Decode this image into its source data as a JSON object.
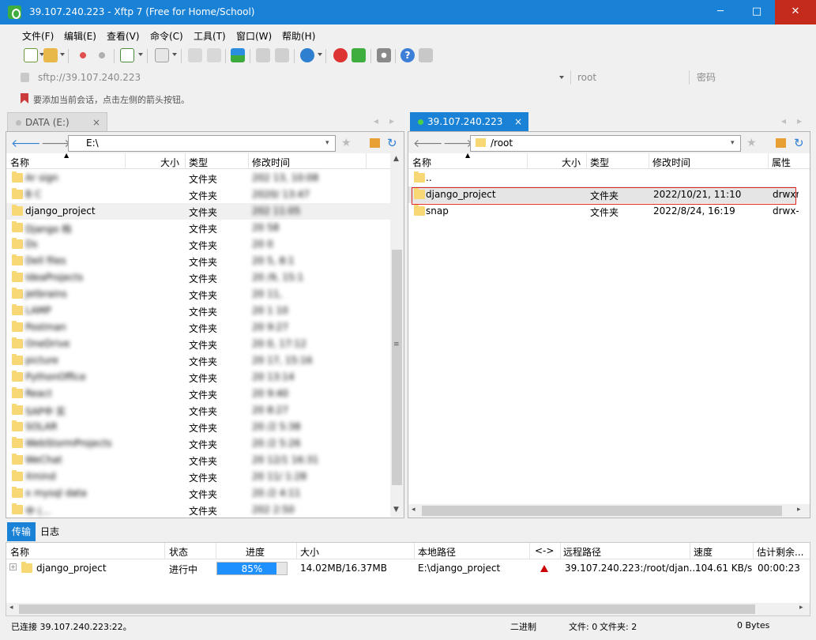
{
  "window": {
    "title": "39.107.240.223 - Xftp 7 (Free for Home/School)",
    "min": "─",
    "max": "□",
    "close": "✕"
  },
  "menu": [
    "文件(F)",
    "编辑(E)",
    "查看(V)",
    "命令(C)",
    "工具(T)",
    "窗口(W)",
    "帮助(H)"
  ],
  "address": {
    "url": "sftp://39.107.240.223",
    "user": "root",
    "password_placeholder": "密码"
  },
  "hint": "要添加当前会话，点击左侧的箭头按钮。",
  "left_pane": {
    "tab": "DATA (E:)",
    "path": "E:\\",
    "columns": [
      "名称",
      "大小",
      "类型",
      "修改时间"
    ],
    "rows": [
      {
        "name": "Ar      sign",
        "type": "文件夹",
        "modified": "202     13, 10:08"
      },
      {
        "name": "B          C",
        "type": "文件夹",
        "modified": "2020/      13:47"
      },
      {
        "name": "django_project",
        "type": "文件夹",
        "modified": "202        11:05"
      },
      {
        "name": "Django        档",
        "type": "文件夹",
        "modified": "20          58"
      },
      {
        "name": "Ds",
        "type": "文件夹",
        "modified": "20          0"
      },
      {
        "name": "Dell files",
        "type": "文件夹",
        "modified": "20       5, 8:1"
      },
      {
        "name": "IdeaProjects",
        "type": "文件夹",
        "modified": "20     /9, 15:1"
      },
      {
        "name": "Jetbrains",
        "type": "文件夹",
        "modified": "20      11,"
      },
      {
        "name": "LAMP",
        "type": "文件夹",
        "modified": "20        1 10"
      },
      {
        "name": "Postman",
        "type": "文件夹",
        "modified": "20         9:27"
      },
      {
        "name": "OneDrive",
        "type": "文件夹",
        "modified": "20        0, 17:12"
      },
      {
        "name": "picture",
        "type": "文件夹",
        "modified": "20        17, 15:16"
      },
      {
        "name": "PythonOffice",
        "type": "文件夹",
        "modified": "20         13:14"
      },
      {
        "name": "React",
        "type": "文件夹",
        "modified": "20          9:40"
      },
      {
        "name": "SAP中  实 ",
        "type": "文件夹",
        "modified": "20       8:27"
      },
      {
        "name": "SOLAR",
        "type": "文件夹",
        "modified": "20      /2   5:38"
      },
      {
        "name": "WebStormProjects",
        "type": "文件夹",
        "modified": "20      /2   5:26"
      },
      {
        "name": "WeChat",
        "type": "文件夹",
        "modified": "20  12/1  16:31"
      },
      {
        "name": "Xmind",
        "type": "文件夹",
        "modified": "20   11/   1:28"
      },
      {
        "name": "x mysql data",
        "type": "文件夹",
        "modified": "20      /2   4:11"
      },
      {
        "name": "中         (...",
        "type": "文件夹",
        "modified": "202       2:50"
      }
    ]
  },
  "right_pane": {
    "tab": "39.107.240.223",
    "path": "/root",
    "columns": [
      "名称",
      "大小",
      "类型",
      "修改时间",
      "属性"
    ],
    "rows": [
      {
        "name": "..",
        "size": "",
        "type": "",
        "modified": "",
        "attr": ""
      },
      {
        "name": "django_project",
        "size": "",
        "type": "文件夹",
        "modified": "2022/10/21, 11:10",
        "attr": "drwxr-xr"
      },
      {
        "name": "snap",
        "size": "",
        "type": "文件夹",
        "modified": "2022/8/24, 16:19",
        "attr": "drwx-----"
      }
    ]
  },
  "transfer": {
    "tabs": [
      "传输",
      "日志"
    ],
    "columns": [
      "名称",
      "状态",
      "进度",
      "大小",
      "本地路径",
      "<->",
      "远程路径",
      "速度",
      "估计剩余..."
    ],
    "rows": [
      {
        "name": "django_project",
        "status": "进行中",
        "progress": 0.85,
        "progress_text": "85%",
        "size": "14.02MB/16.37MB",
        "local": "E:\\django_project",
        "remote": "39.107.240.223:/root/djan...",
        "speed": "104.61 KB/s",
        "eta": "00:00:23"
      }
    ]
  },
  "status": {
    "connection": "已连接 39.107.240.223:22。",
    "mode": "二进制",
    "files": "文件: 0",
    "folders": "文件夹: 2",
    "bytes": "0 Bytes"
  },
  "colors": {
    "accent": "#1a82d6",
    "progress": "#1e90ff",
    "highlight": "#cc0000"
  }
}
